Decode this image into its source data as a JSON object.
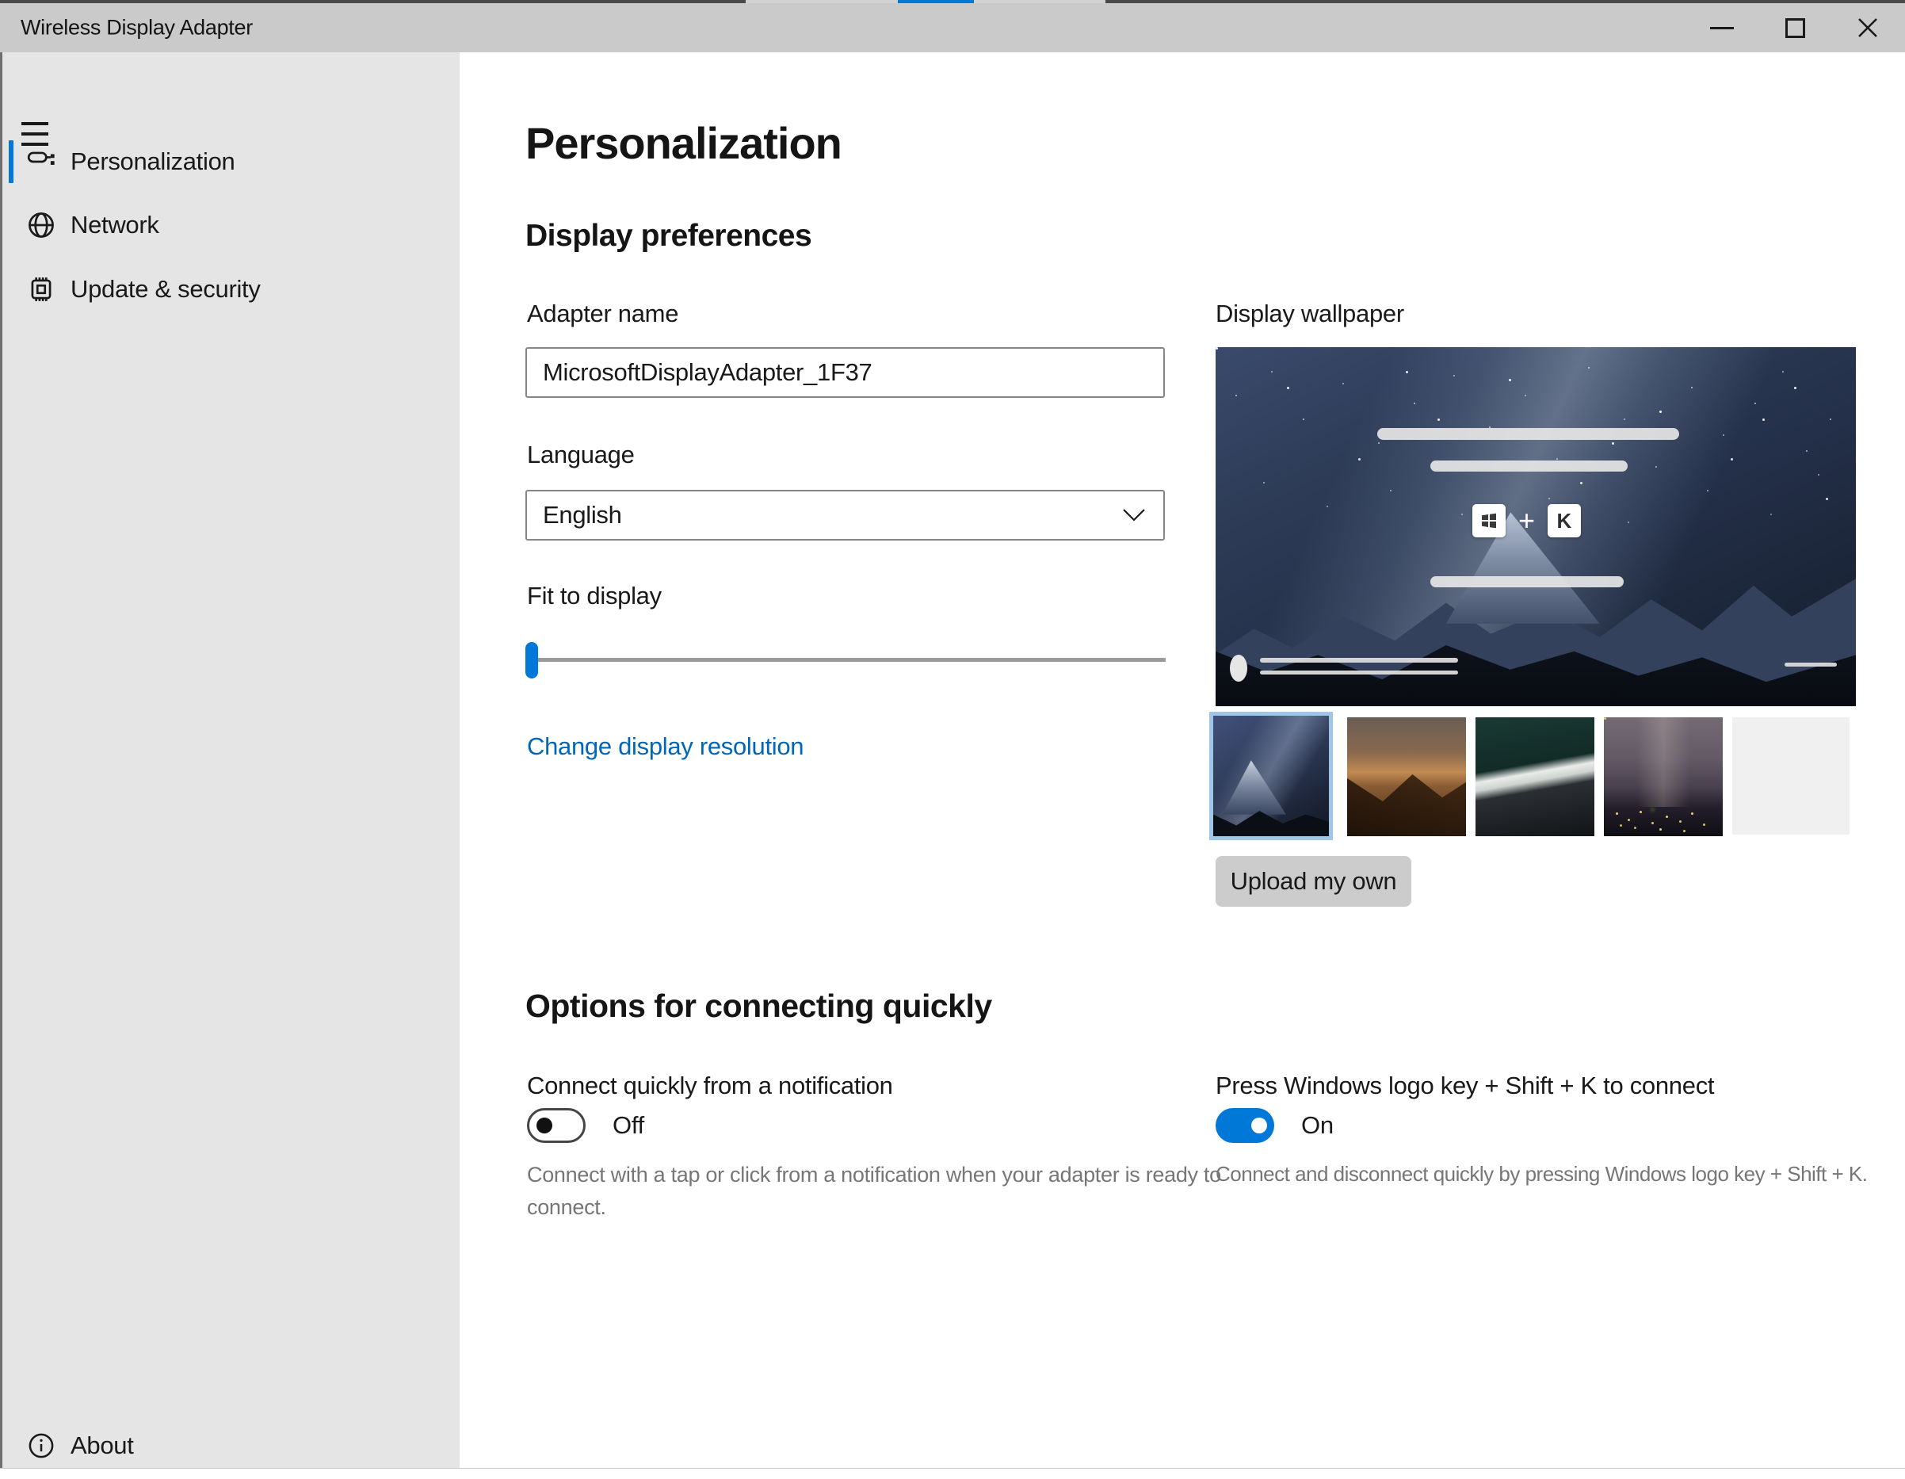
{
  "window": {
    "title": "Wireless Display Adapter",
    "controls": {
      "minimize": "minimize",
      "maximize": "maximize",
      "close": "close"
    }
  },
  "sidebar": {
    "items": [
      {
        "label": "Personalization",
        "icon": "paint-roller-icon",
        "selected": true
      },
      {
        "label": "Network",
        "icon": "globe-icon",
        "selected": false
      },
      {
        "label": "Update & security",
        "icon": "chip-icon",
        "selected": false
      }
    ],
    "about": {
      "label": "About",
      "icon": "info-icon"
    }
  },
  "main": {
    "title": "Personalization",
    "display_preferences": {
      "heading": "Display preferences",
      "adapter_name": {
        "label": "Adapter name",
        "value": "MicrosoftDisplayAdapter_1F37"
      },
      "language": {
        "label": "Language",
        "value": "English"
      },
      "fit_to_display": {
        "label": "Fit to display",
        "value_percent": 0
      },
      "resolution_link": "Change display resolution"
    },
    "wallpaper": {
      "label": "Display wallpaper",
      "shortcut_keys": {
        "win": "windows-logo",
        "plus": "+",
        "k": "K"
      },
      "thumbnails": [
        {
          "name": "starry-mountain",
          "selected": true
        },
        {
          "name": "sunset-valley",
          "selected": false
        },
        {
          "name": "ocean-wave",
          "selected": false
        },
        {
          "name": "night-sky-city",
          "selected": false
        },
        {
          "name": "blank",
          "selected": false
        }
      ],
      "upload_button": "Upload my own"
    },
    "options": {
      "heading": "Options for connecting quickly",
      "notification_toggle": {
        "label": "Connect quickly from a notification",
        "state": "Off",
        "description": "Connect with a tap or click from a notification when your adapter is ready to connect."
      },
      "shortcut_toggle": {
        "label": "Press Windows logo key + Shift + K to connect",
        "state": "On",
        "description": "Connect and disconnect quickly by pressing Windows logo key + Shift + K."
      }
    }
  },
  "colors": {
    "accent": "#0078d7",
    "link": "#0067b8",
    "titlebar": "#cacaca",
    "sidebar": "#e5e5e5",
    "selected_thumb_border": "#9fc6e7"
  }
}
